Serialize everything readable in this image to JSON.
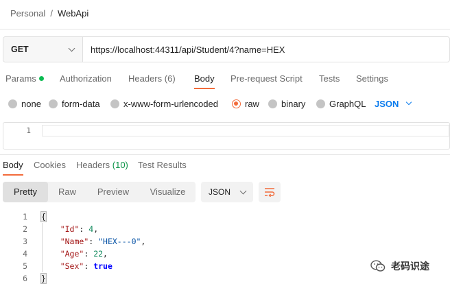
{
  "breadcrumb": {
    "parent": "Personal",
    "separator": "/",
    "current": "WebApi"
  },
  "request": {
    "method": "GET",
    "url": "https://localhost:44311/api/Student/4?name=HEX"
  },
  "request_tabs": {
    "params": "Params",
    "authorization": "Authorization",
    "headers": "Headers",
    "headers_count": "(6)",
    "body": "Body",
    "pre_request": "Pre-request Script",
    "tests": "Tests",
    "settings": "Settings",
    "active": "Body"
  },
  "body_types": {
    "none": "none",
    "form_data": "form-data",
    "urlencoded": "x-www-form-urlencoded",
    "raw": "raw",
    "binary": "binary",
    "graphql": "GraphQL",
    "selected": "raw",
    "language": "JSON"
  },
  "request_editor": {
    "line_number": "1"
  },
  "response_tabs": {
    "body": "Body",
    "cookies": "Cookies",
    "headers": "Headers",
    "headers_count": "(10)",
    "test_results": "Test Results",
    "active": "Body"
  },
  "response_view": {
    "pretty": "Pretty",
    "raw": "Raw",
    "preview": "Preview",
    "visualize": "Visualize",
    "active": "Pretty",
    "format": "JSON"
  },
  "response_body": {
    "line_numbers": [
      "1",
      "2",
      "3",
      "4",
      "5",
      "6"
    ],
    "open_brace": "{",
    "close_brace": "}",
    "fields": [
      {
        "key": "\"Id\"",
        "value": "4",
        "type": "number",
        "comma": ","
      },
      {
        "key": "\"Name\"",
        "value": "\"HEX---0\"",
        "type": "string",
        "comma": ","
      },
      {
        "key": "\"Age\"",
        "value": "22",
        "type": "number",
        "comma": ","
      },
      {
        "key": "\"Sex\"",
        "value": "true",
        "type": "boolean",
        "comma": ""
      }
    ]
  },
  "watermark": {
    "text": "老码识途"
  },
  "colors": {
    "accent": "#f26b3a",
    "link_blue": "#097bed",
    "param_dot": "#0cbb52"
  }
}
